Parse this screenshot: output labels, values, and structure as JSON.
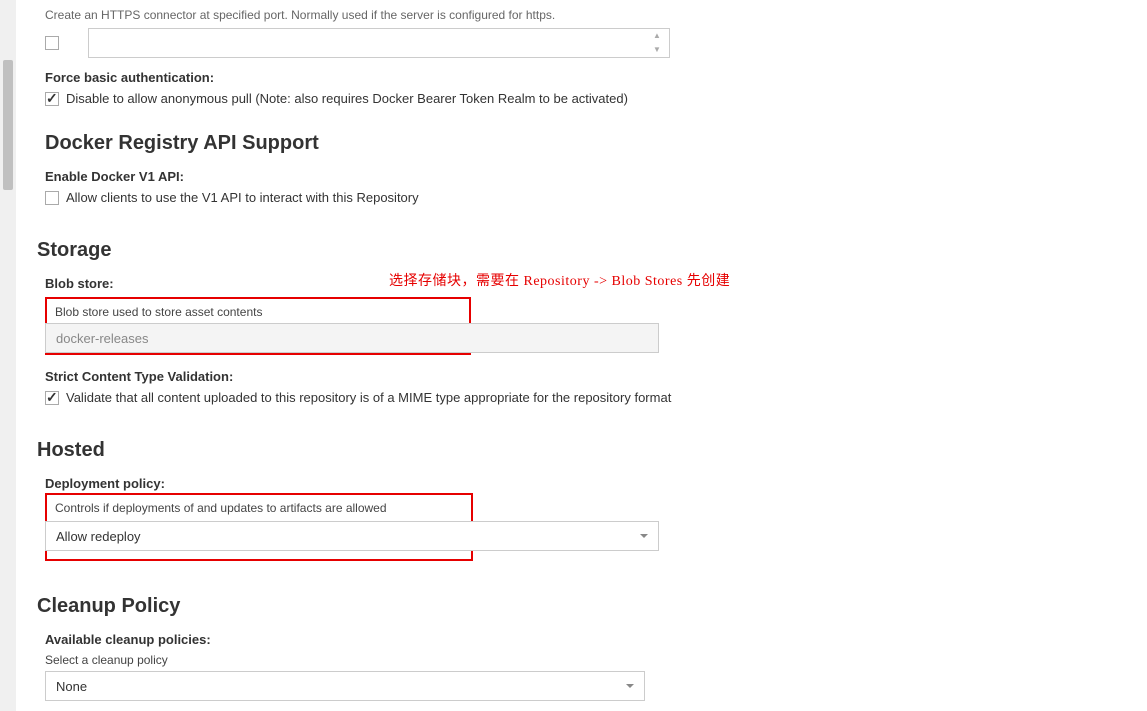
{
  "https_connector": {
    "desc": "Create an HTTPS connector at specified port. Normally used if the server is configured for https.",
    "checked": false
  },
  "force_basic_auth": {
    "label": "Force basic authentication:",
    "checked": true,
    "checkbox_label": "Disable to allow anonymous pull (Note: also requires Docker Bearer Token Realm to be activated)"
  },
  "docker_api": {
    "section_title": "Docker Registry API Support",
    "v1_label": "Enable Docker V1 API:",
    "v1_checked": false,
    "v1_checkbox_label": "Allow clients to use the V1 API to interact with this Repository"
  },
  "storage": {
    "section_title": "Storage",
    "annotation": "选择存储块，需要在 Repository -> Blob Stores 先创建",
    "blob_store_label": "Blob store:",
    "blob_store_desc": "Blob store used to store asset contents",
    "blob_store_value": "docker-releases",
    "strict_label": "Strict Content Type Validation:",
    "strict_checked": true,
    "strict_checkbox_label": "Validate that all content uploaded to this repository is of a MIME type appropriate for the repository format"
  },
  "hosted": {
    "section_title": "Hosted",
    "deploy_label": "Deployment policy:",
    "deploy_desc": "Controls if deployments of and updates to artifacts are allowed",
    "deploy_value": "Allow redeploy"
  },
  "cleanup": {
    "section_title": "Cleanup Policy",
    "available_label": "Available cleanup policies:",
    "select_desc": "Select a cleanup policy",
    "select_value": "None"
  }
}
